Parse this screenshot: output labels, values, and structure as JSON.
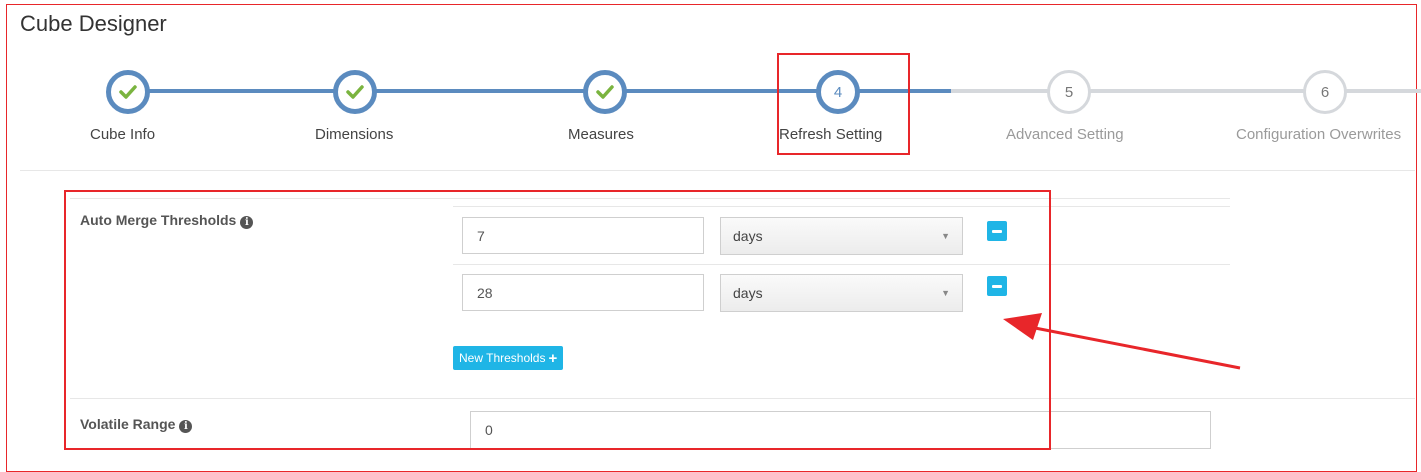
{
  "app_title": "Cube Designer",
  "steps": [
    {
      "number": "1",
      "label": "Cube Info",
      "state": "done",
      "icon": "check-icon"
    },
    {
      "number": "2",
      "label": "Dimensions",
      "state": "done",
      "icon": "check-icon"
    },
    {
      "number": "3",
      "label": "Measures",
      "state": "done",
      "icon": "check-icon"
    },
    {
      "number": "4",
      "label": "Refresh Setting",
      "state": "active"
    },
    {
      "number": "5",
      "label": "Advanced Setting",
      "state": "todo"
    },
    {
      "number": "6",
      "label": "Configuration Overwrites",
      "state": "todo"
    }
  ],
  "form": {
    "auto_merge": {
      "label": "Auto Merge Thresholds",
      "thresholds": [
        {
          "value": "7",
          "unit": "days"
        },
        {
          "value": "28",
          "unit": "days"
        }
      ],
      "new_button_label": "New Thresholds"
    },
    "volatile_range": {
      "label": "Volatile Range",
      "value": "0"
    }
  },
  "colors": {
    "accent": "#5b8bbf",
    "check": "#7ab43f",
    "button": "#1fb5e6",
    "annotation": "#e8262a"
  }
}
